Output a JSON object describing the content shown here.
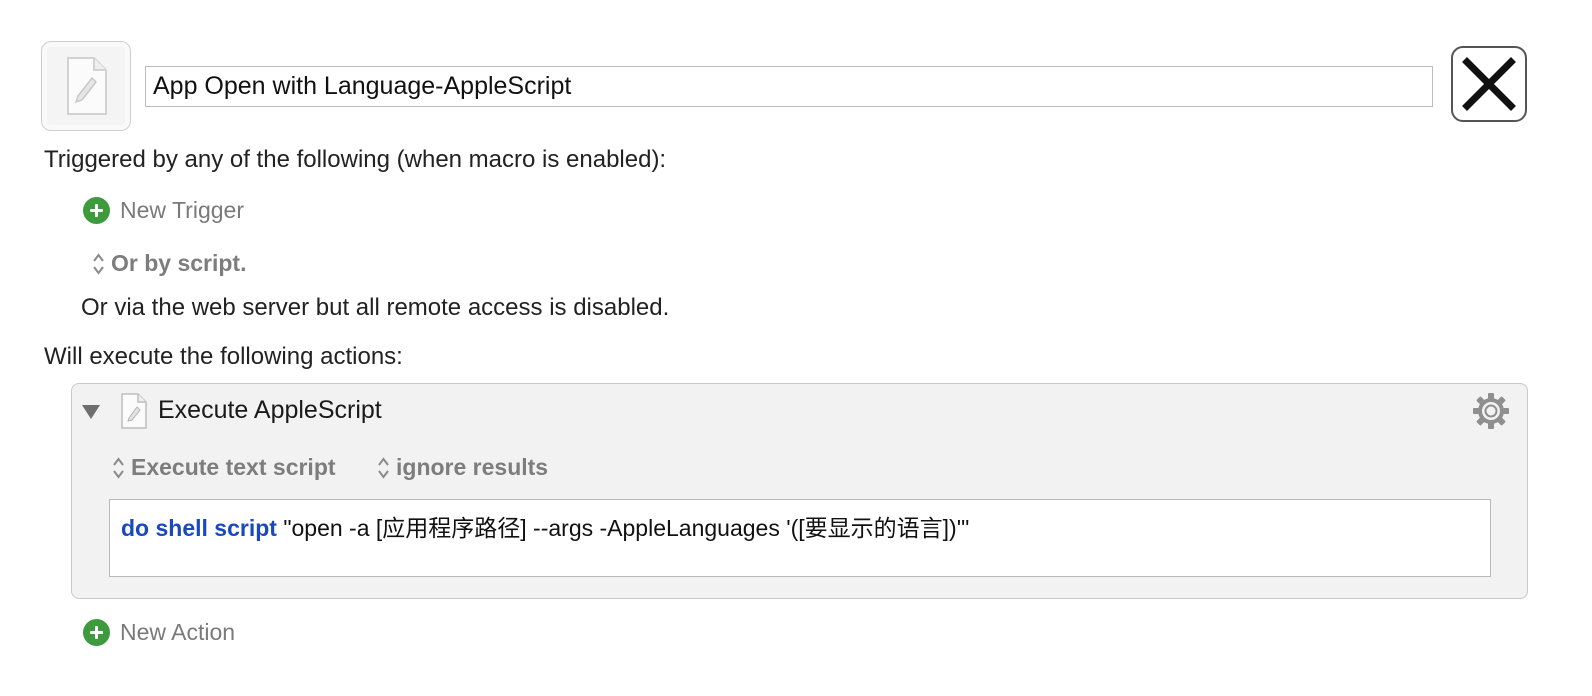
{
  "header": {
    "macro_icon": "applescript-document-icon",
    "macro_name": "App Open with Language-AppleScript",
    "close_icon": "close-x-icon"
  },
  "triggers": {
    "heading": "Triggered by any of the following (when macro is enabled):",
    "new_trigger_label": "New Trigger",
    "or_by_script_label": "Or by script.",
    "web_server_note": "Or via the web server but all remote access is disabled."
  },
  "actions": {
    "heading": "Will execute the following actions:",
    "items": [
      {
        "title": "Execute AppleScript",
        "icon": "applescript-document-icon",
        "execute_option": "Execute text script",
        "results_option": "ignore results",
        "script": {
          "keyword": "do shell script",
          "text": " \"open -a [应用程序路径] --args -AppleLanguages '([要显示的语言])'\""
        }
      }
    ],
    "new_action_label": "New Action"
  },
  "colors": {
    "accent_green": "#3d9a3d",
    "script_keyword_blue": "#1a48c0",
    "card_background": "#f2f2f2"
  }
}
